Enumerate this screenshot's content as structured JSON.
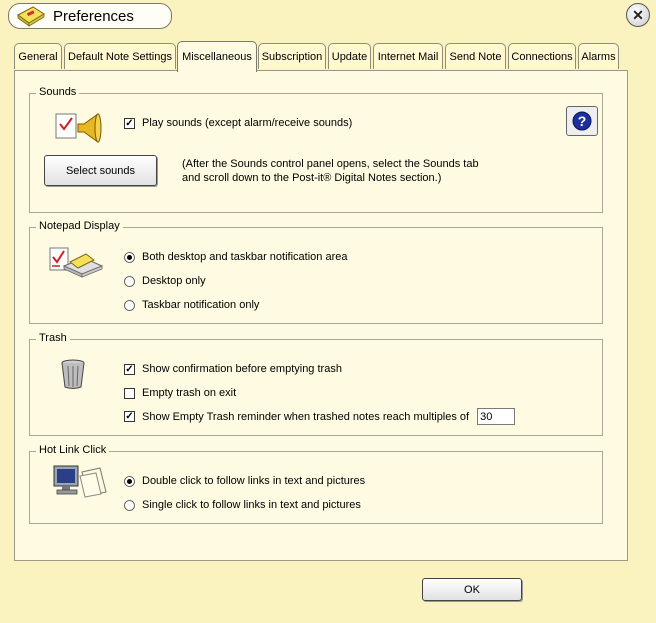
{
  "window": {
    "title": "Preferences",
    "close_glyph": "✕"
  },
  "tabs": [
    {
      "label": "General"
    },
    {
      "label": "Default Note Settings"
    },
    {
      "label": "Miscellaneous"
    },
    {
      "label": "Subscription"
    },
    {
      "label": "Update"
    },
    {
      "label": "Internet Mail"
    },
    {
      "label": "Send Note"
    },
    {
      "label": "Connections"
    },
    {
      "label": "Alarms"
    }
  ],
  "active_tab": "Miscellaneous",
  "sounds": {
    "label": "Sounds",
    "play_sounds": {
      "label": "Play sounds (except alarm/receive sounds)",
      "checked": true
    },
    "select_button": "Select sounds",
    "note_line1": "(After the Sounds control panel opens, select the Sounds tab",
    "note_line2": "and  scroll down to the Post-it® Digital Notes section.)",
    "help_icon": "help-question-icon"
  },
  "notepad": {
    "label": "Notepad Display",
    "options": [
      {
        "label": "Both desktop and taskbar notification area",
        "selected": true
      },
      {
        "label": "Desktop only",
        "selected": false
      },
      {
        "label": "Taskbar notification only",
        "selected": false
      }
    ]
  },
  "trash": {
    "label": "Trash",
    "confirm": {
      "label": "Show confirmation before emptying trash",
      "checked": true
    },
    "empty_on_exit": {
      "label": "Empty trash on exit",
      "checked": false
    },
    "reminder": {
      "label": "Show Empty Trash reminder when trashed notes reach multiples of",
      "checked": true
    },
    "reminder_value": "30"
  },
  "hotlink": {
    "label": "Hot Link Click",
    "options": [
      {
        "label": "Double click to follow links in text and pictures",
        "selected": true
      },
      {
        "label": "Single click to follow links in text and pictures",
        "selected": false
      }
    ]
  },
  "ok_button": "OK",
  "colors": {
    "background": "#fbf3bf",
    "panel": "#fffbe2",
    "tab": "#fff8d0"
  }
}
